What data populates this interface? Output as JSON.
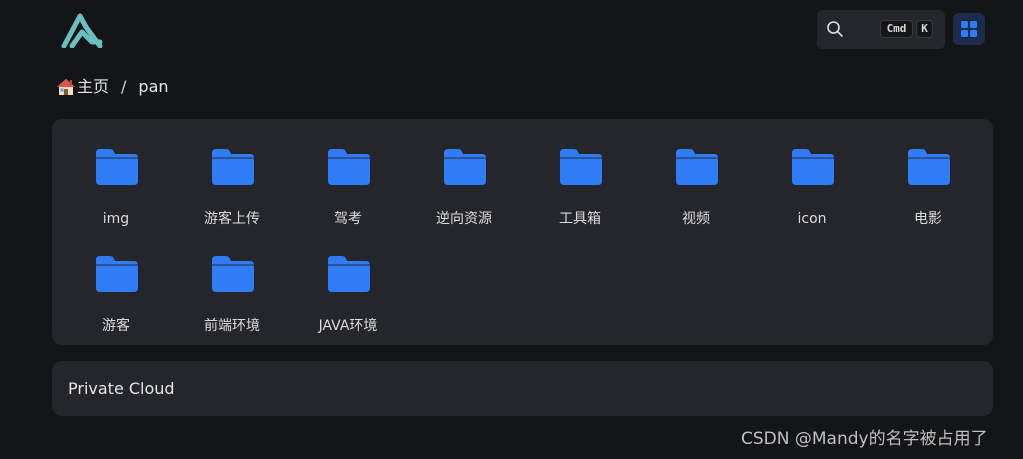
{
  "header": {
    "search": {
      "icon": "search-icon",
      "shortcut_modifier": "Cmd",
      "shortcut_key": "K"
    },
    "grid_button_icon": "grid-icon",
    "accent_color": "#2f7cf6",
    "logo_color": "#6bbfc0"
  },
  "breadcrumb": {
    "home_icon": "house-icon",
    "home_label": "主页",
    "separator": "/",
    "current": "pan"
  },
  "folders": [
    {
      "label": "img"
    },
    {
      "label": "游客上传"
    },
    {
      "label": "驾考"
    },
    {
      "label": "逆向资源"
    },
    {
      "label": "工具箱"
    },
    {
      "label": "视频"
    },
    {
      "label": "icon"
    },
    {
      "label": "电影"
    },
    {
      "label": "游客"
    },
    {
      "label": "前端环境"
    },
    {
      "label": "JAVA环境"
    }
  ],
  "footer_panel": {
    "title": "Private Cloud"
  },
  "watermark": "CSDN @Mandy的名字被占用了"
}
